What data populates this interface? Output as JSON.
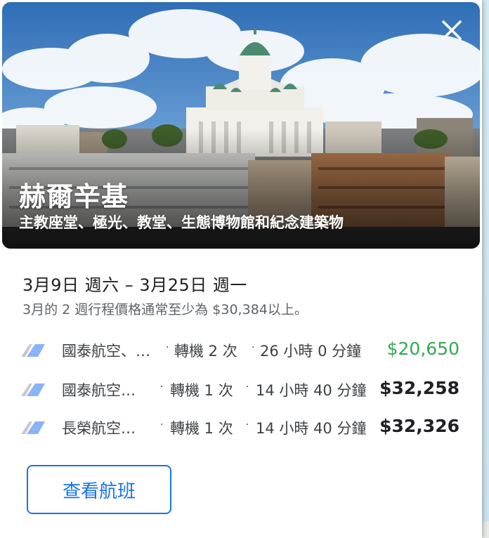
{
  "destination": {
    "title": "赫爾辛基",
    "subtitle": "主教座堂、極光、教堂、生態博物館和紀念建築物"
  },
  "trip": {
    "dates": "3月9日 週六 – 3月25日 週一",
    "price_note": "3月的 2 週行程價格通常至少為 $30,384以上。"
  },
  "flights": [
    {
      "airline": "國泰航空、…",
      "stops": "轉機 2 次",
      "duration": "26 小時 0 分鐘",
      "price": "$20,650",
      "price_color": "#34a853"
    },
    {
      "airline": "國泰航空…",
      "stops": "轉機 1 次",
      "duration": "14 小時 40 分鐘",
      "price": "$32,258",
      "price_color": "#202124"
    },
    {
      "airline": "長榮航空…",
      "stops": "轉機 1 次",
      "duration": "14 小時 40 分鐘",
      "price": "$32,326",
      "price_color": "#202124"
    }
  ],
  "actions": {
    "view_flights_label": "查看航班"
  },
  "icons": {
    "close": "close-icon",
    "airline_logo": "airline-logo-icon"
  },
  "colors": {
    "accent": "#1a73e8",
    "cheap_price": "#34a853"
  }
}
